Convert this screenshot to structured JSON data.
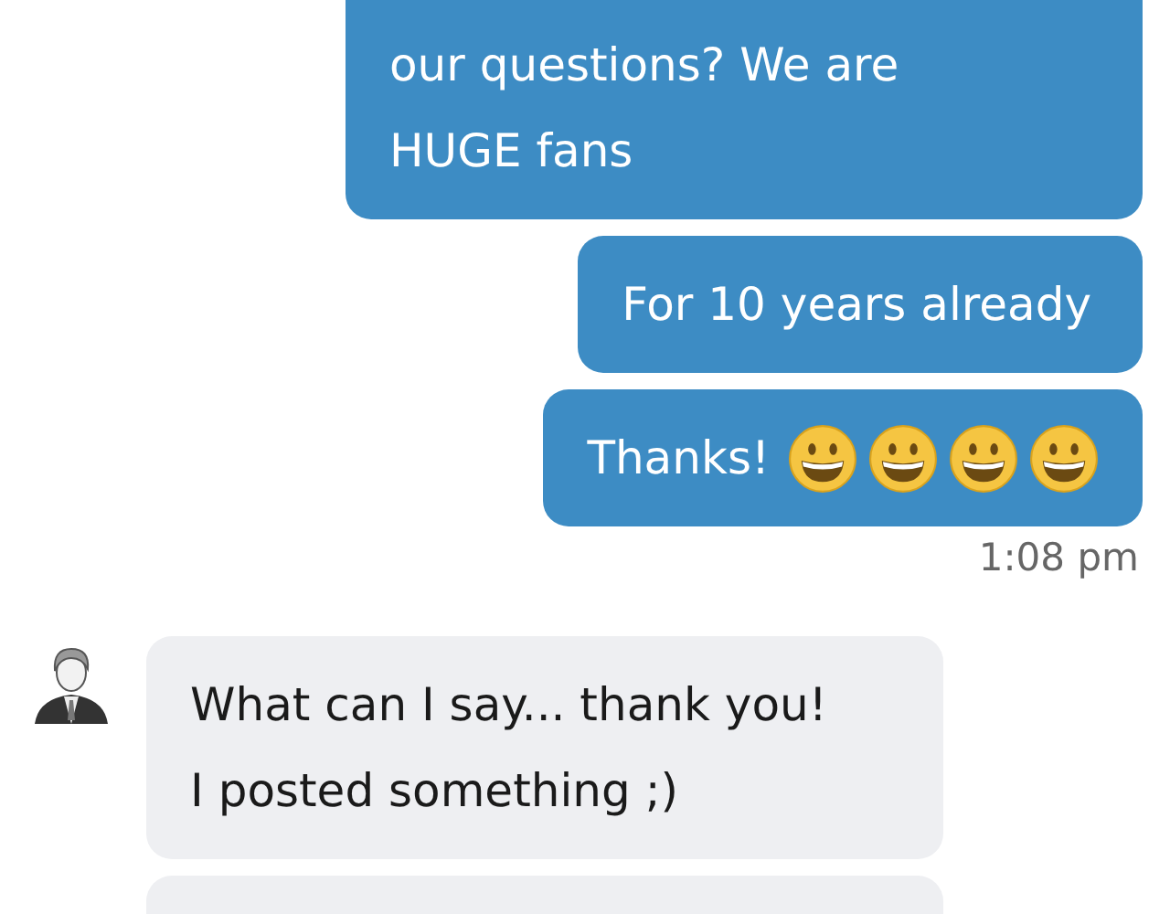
{
  "messages": [
    {
      "kind": "outgoing",
      "cut_top": true,
      "text": "our questions? We are\nHUGE fans"
    },
    {
      "kind": "outgoing",
      "text": "For 10 years already"
    },
    {
      "kind": "outgoing",
      "text": "Thanks!",
      "emojis": [
        {
          "kind": "grin"
        },
        {
          "kind": "grin"
        },
        {
          "kind": "grin"
        },
        {
          "kind": "grin"
        }
      ]
    },
    {
      "kind": "timestamp",
      "text": "1:08 pm"
    },
    {
      "kind": "incoming",
      "avatar": true,
      "text": "What can I say... thank you!\nI posted something ;)"
    },
    {
      "kind": "incoming",
      "avatar": false,
      "cut_bottom": true
    }
  ]
}
